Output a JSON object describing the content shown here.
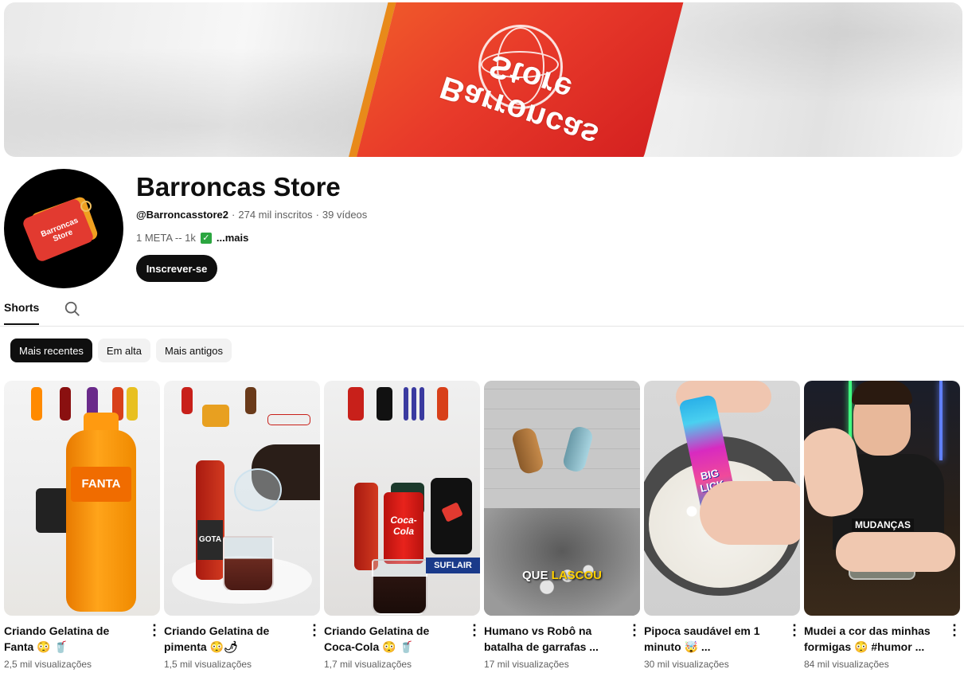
{
  "channel": {
    "name": "Barroncas Store",
    "handle": "@Barroncasstore2",
    "subscribers": "274 mil inscritos",
    "videos": "39 vídeos",
    "description": "1 META -- 1k",
    "more_label": "...mais",
    "subscribe_label": "Inscrever-se",
    "banner_text": "Barroncas Store",
    "avatar_text": "Barroncas Store"
  },
  "tabs": {
    "shorts_label": "Shorts",
    "search_icon": "search-icon"
  },
  "chips": [
    "Mais recentes",
    "Em alta",
    "Mais antigos"
  ],
  "shorts": [
    {
      "title": "Criando Gelatina de Fanta 😳 🥤",
      "views": "2,5 mil visualizações"
    },
    {
      "title": "Criando Gelatina de pimenta 😳🌶",
      "views": "1,5 mil visualizações"
    },
    {
      "title": "Criando Gelatina de Coca-Cola 😳 🥤",
      "views": "1,7 mil visualizações"
    },
    {
      "title": "Humano vs Robô na batalha de garrafas ...",
      "views": "17 mil visualizações"
    },
    {
      "title": "Pipoca saudável em 1 minuto 🤯 ...",
      "views": "30 mil visualizações"
    },
    {
      "title": "Mudei a cor das minhas formigas 😳 #humor ...",
      "views": "84 mil visualizações"
    }
  ],
  "thumb_text": {
    "fanta": "FANTA",
    "gota": "GOTA",
    "coca": "Coca-Cola",
    "gota2": "GOTA",
    "snack": "SUFLAIR",
    "caption4_a": "QUE ",
    "caption4_b": "LASCOU",
    "candy": "BIG LICK",
    "caption6": "MUDANÇAS"
  },
  "colors": {
    "accent": "#0f0f0f",
    "chip_bg": "#f2f2f2",
    "check": "#2ba640",
    "brand_red": "#e23a30"
  }
}
